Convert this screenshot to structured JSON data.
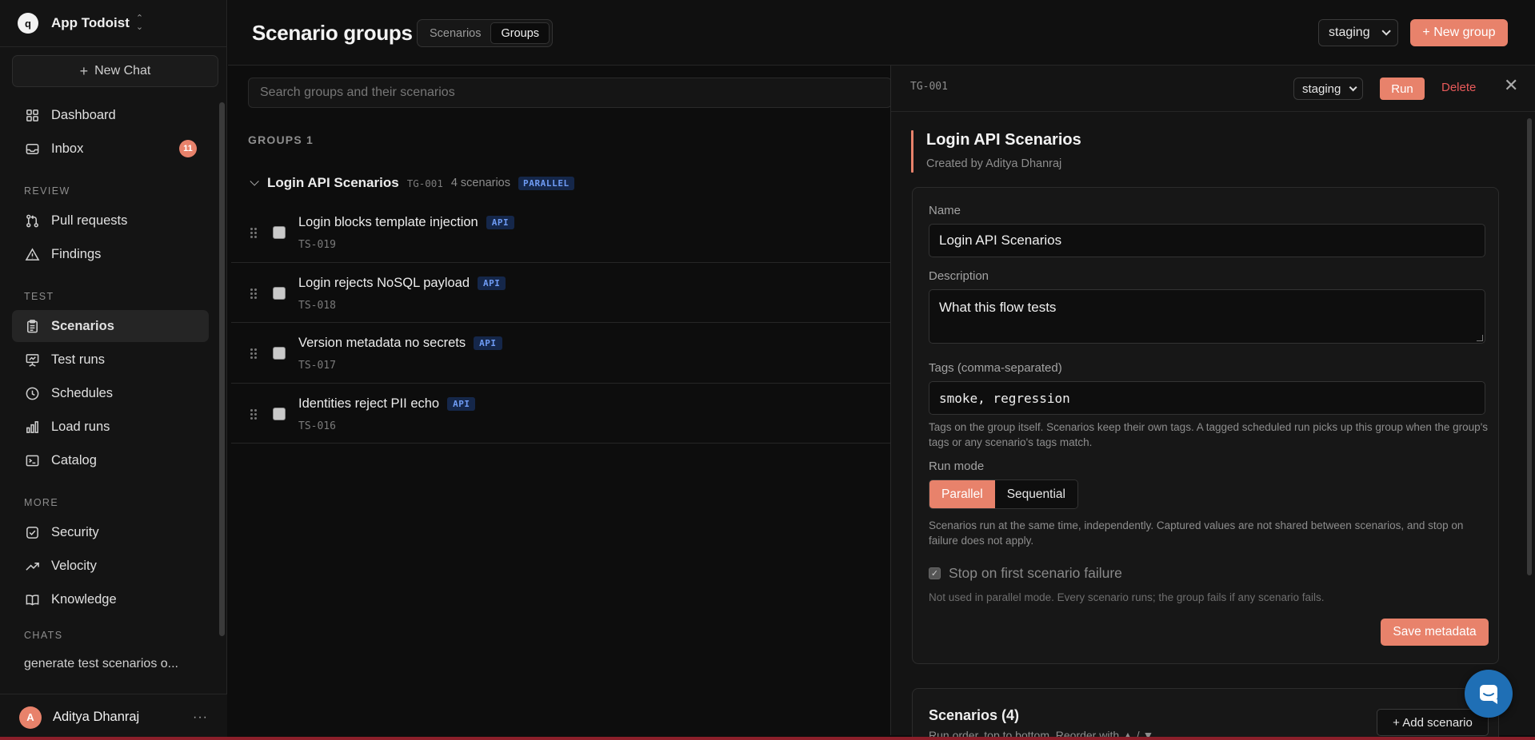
{
  "workspace": {
    "logo_letter": "q",
    "name": "App Todoist"
  },
  "sidebar": {
    "new_chat_label": "New Chat",
    "items_top": [
      {
        "label": "Dashboard",
        "icon": "grid-icon"
      },
      {
        "label": "Inbox",
        "icon": "inbox-icon",
        "badge": "11"
      }
    ],
    "section_review": "REVIEW",
    "items_review": [
      {
        "label": "Pull requests",
        "icon": "git-pull-request-icon"
      },
      {
        "label": "Findings",
        "icon": "warning-triangle-icon"
      }
    ],
    "section_test": "TEST",
    "items_test": [
      {
        "label": "Scenarios",
        "icon": "clipboard-icon",
        "active": true
      },
      {
        "label": "Test runs",
        "icon": "presentation-icon"
      },
      {
        "label": "Schedules",
        "icon": "clock-icon"
      },
      {
        "label": "Load runs",
        "icon": "bar-chart-icon"
      },
      {
        "label": "Catalog",
        "icon": "terminal-icon"
      }
    ],
    "section_more": "MORE",
    "items_more": [
      {
        "label": "Security",
        "icon": "check-square-icon"
      },
      {
        "label": "Velocity",
        "icon": "trending-up-icon"
      },
      {
        "label": "Knowledge",
        "icon": "book-icon"
      }
    ],
    "section_chats": "CHATS",
    "chats": [
      "generate test scenarios o..."
    ],
    "user": {
      "initial": "A",
      "name": "Aditya Dhanraj"
    }
  },
  "header": {
    "title": "Scenario groups",
    "tabs": [
      {
        "label": "Scenarios"
      },
      {
        "label": "Groups",
        "active": true
      }
    ],
    "env": "staging",
    "new_group_label": "+ New group"
  },
  "list": {
    "search_placeholder": "Search groups and their scenarios",
    "groups_label": "GROUPS 1",
    "group": {
      "title": "Login API Scenarios",
      "id": "TG-001",
      "count": "4 scenarios",
      "mode_pill": "PARALLEL"
    },
    "scenarios": [
      {
        "title": "Login blocks template injection",
        "tag": "API",
        "id": "TS-019"
      },
      {
        "title": "Login rejects NoSQL payload",
        "tag": "API",
        "id": "TS-018"
      },
      {
        "title": "Version metadata no secrets",
        "tag": "API",
        "id": "TS-017"
      },
      {
        "title": "Identities reject PII echo",
        "tag": "API",
        "id": "TS-016"
      }
    ]
  },
  "panel": {
    "id": "TG-001",
    "env": "staging",
    "run_label": "Run",
    "delete_label": "Delete",
    "close_glyph": "✕",
    "title": "Login API Scenarios",
    "created_by": "Created by Aditya Dhanraj",
    "name_label": "Name",
    "name_value": "Login API Scenarios",
    "description_label": "Description",
    "description_value": "What this flow tests",
    "tags_label": "Tags (comma-separated)",
    "tags_value": "smoke, regression",
    "tags_help": "Tags on the group itself. Scenarios keep their own tags. A tagged scheduled run picks up this group when the group's tags or any scenario's tags match.",
    "run_mode_label": "Run mode",
    "run_modes": [
      {
        "label": "Parallel",
        "active": true
      },
      {
        "label": "Sequential"
      }
    ],
    "run_mode_help": "Scenarios run at the same time, independently. Captured values are not shared between scenarios, and stop on failure does not apply.",
    "stop_label": "Stop on first scenario failure",
    "stop_help": "Not used in parallel mode. Every scenario runs; the group fails if any scenario fails.",
    "save_label": "Save metadata",
    "scenarios_title": "Scenarios (4)",
    "scenarios_sub": "Run order, top to bottom. Reorder with ▲ / ▼.",
    "add_scenario_label": "+ Add scenario"
  },
  "colors": {
    "accent": "#e8826b",
    "api_pill_bg": "#15274a",
    "api_pill_text": "#6f9cf5",
    "danger": "#e85a5a",
    "chat_bubble": "#1f6fb5"
  }
}
